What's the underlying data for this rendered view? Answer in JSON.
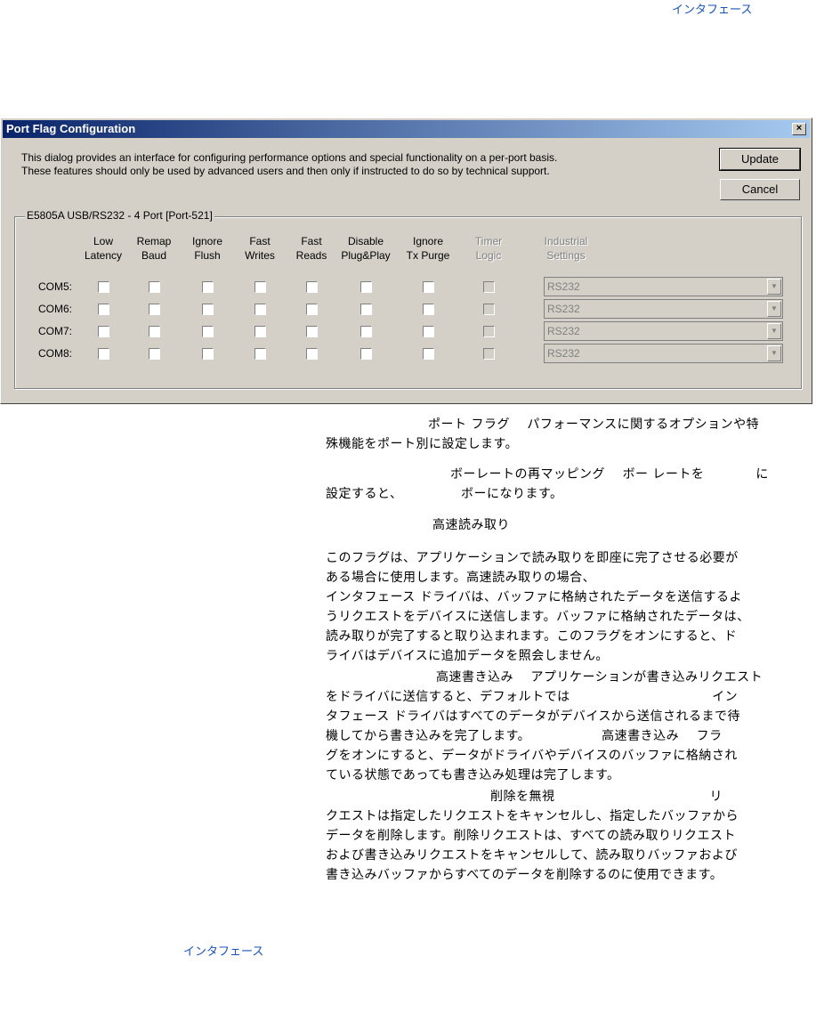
{
  "page": {
    "header_link": "インタフェース",
    "footer_link": "インタフェース"
  },
  "dialog": {
    "title": "Port Flag Configuration",
    "close_label": "×",
    "description_line1": "This dialog provides an interface for configuring performance options and special functionality on a per-port basis.",
    "description_line2": "These features should only be used by advanced users and then only if instructed to do so by technical support.",
    "update_label": "Update",
    "cancel_label": "Cancel",
    "group_title": "E5805A USB/RS232 - 4 Port [Port-521]",
    "columns": [
      {
        "line1": "Low",
        "line2": "Latency",
        "enabled": true
      },
      {
        "line1": "Remap",
        "line2": "Baud",
        "enabled": true
      },
      {
        "line1": "Ignore",
        "line2": "Flush",
        "enabled": true
      },
      {
        "line1": "Fast",
        "line2": "Writes",
        "enabled": true
      },
      {
        "line1": "Fast",
        "line2": "Reads",
        "enabled": true
      },
      {
        "line1": "Disable",
        "line2": "Plug&Play",
        "enabled": true
      },
      {
        "line1": "Ignore",
        "line2": "Tx Purge",
        "enabled": true
      },
      {
        "line1": "Timer",
        "line2": "Logic",
        "enabled": false
      },
      {
        "line1": "Industrial",
        "line2": "Settings",
        "enabled": false
      }
    ],
    "rows": [
      {
        "label": "COM5:",
        "setting": "RS232"
      },
      {
        "label": "COM6:",
        "setting": "RS232"
      },
      {
        "label": "COM7:",
        "setting": "RS232"
      },
      {
        "label": "COM8:",
        "setting": "RS232"
      }
    ]
  },
  "body_text": {
    "p1_l1": "ポート フラグ　 パフォーマンスに関するオプションや特",
    "p1_l2": "殊機能をポート別に設定します。",
    "p2_l1": "ボーレートの再マッピング　 ボー レートを　　　　に",
    "p2_l2": "設定すると、　　　　　ボーになります。",
    "p3_heading": "高速読み取り",
    "p3_l1": "このフラグは、アプリケーションで読み取りを即座に完了させる必要が",
    "p3_l2": "ある場合に使用します。高速読み取りの場合、",
    "p3_l3": "インタフェース ドライバは、バッファに格納されたデータを送信するよ",
    "p3_l4": "うリクエストをデバイスに送信します。バッファに格納されたデータは、",
    "p3_l5": "読み取りが完了すると取り込まれます。このフラグをオンにすると、ド",
    "p3_l6": "ライバはデバイスに追加データを照会しません。",
    "p4_l1": "高速書き込み　 アプリケーションが書き込みリクエスト",
    "p4_l2": "をドライバに送信すると、デフォルトでは　　　　　　　　　　　イン",
    "p4_l3": "タフェース ドライバはすべてのデータがデバイスから送信されるまで待",
    "p4_l4": "機してから書き込みを完了します。　　　　　　高速書き込み　 フラ",
    "p4_l5": "グをオンにすると、データがドライバやデバイスのバッファに格納され",
    "p4_l6": "ている状態であっても書き込み処理は完了します。",
    "p5_l1": "削除を無視　　　　　　　　　　　　リ",
    "p5_l2": "クエストは指定したリクエストをキャンセルし、指定したバッファから",
    "p5_l3": "データを削除します。削除リクエストは、すべての読み取りリクエスト",
    "p5_l4": "および書き込みリクエストをキャンセルして、読み取りバッファおよび",
    "p5_l5": "書き込みバッファからすべてのデータを削除するのに使用できます。"
  }
}
